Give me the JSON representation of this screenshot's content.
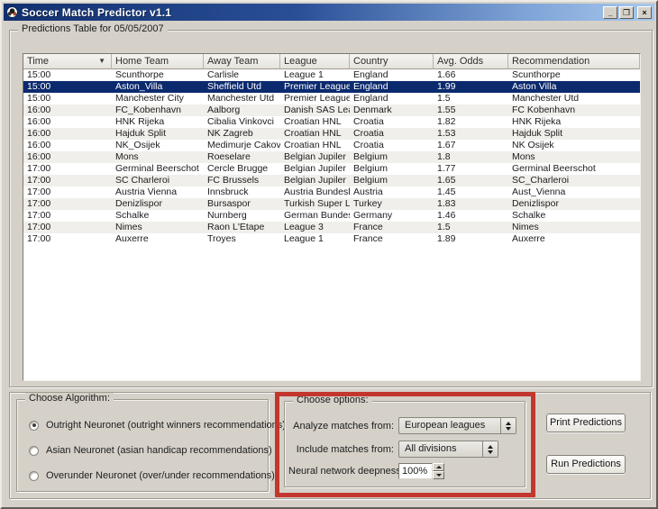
{
  "window": {
    "title": "Soccer Match Predictor v1.1",
    "controls": {
      "minimize": "_",
      "maximize": "❐",
      "close": "×"
    }
  },
  "colors": {
    "title_gradient_left": "#12306f",
    "title_gradient_right": "#a7c8ee",
    "selection": "#0b2a6e",
    "highlight_red": "#c2362d",
    "window_bg": "#d5d1c9"
  },
  "predictions_group": {
    "title": "Predictions Table for 05/05/2007"
  },
  "table": {
    "columns": [
      "Time",
      "Home Team",
      "Away Team",
      "League",
      "Country",
      "Avg. Odds",
      "Recommendation"
    ],
    "sort_column_index": 0,
    "sort_icon": "▼",
    "selected_row_index": 1,
    "rows": [
      [
        "15:00",
        "Scunthorpe",
        "Carlisle",
        "League 1",
        "England",
        "1.66",
        "Scunthorpe"
      ],
      [
        "15:00",
        "Aston_Villa",
        "Sheffield Utd",
        "Premier League",
        "England",
        "1.99",
        "Aston Villa"
      ],
      [
        "15:00",
        "Manchester City",
        "Manchester Utd",
        "Premier League",
        "England",
        "1.5",
        "Manchester Utd"
      ],
      [
        "16:00",
        "FC_Kobenhavn",
        "Aalborg",
        "Danish SAS League",
        "Denmark",
        "1.55",
        "FC Kobenhavn"
      ],
      [
        "16:00",
        "HNK Rijeka",
        "Cibalia Vinkovci",
        "Croatian HNL",
        "Croatia",
        "1.82",
        "HNK Rijeka"
      ],
      [
        "16:00",
        "Hajduk Split",
        "NK Zagreb",
        "Croatian HNL",
        "Croatia",
        "1.53",
        "Hajduk Split"
      ],
      [
        "16:00",
        "NK_Osijek",
        "Medimurje Cakovec",
        "Croatian HNL",
        "Croatia",
        "1.67",
        "NK Osijek"
      ],
      [
        "16:00",
        "Mons",
        "Roeselare",
        "Belgian Jupiler",
        "Belgium",
        "1.8",
        "Mons"
      ],
      [
        "17:00",
        "Germinal Beerschot",
        "Cercle Brugge",
        "Belgian Jupiler",
        "Belgium",
        "1.77",
        "Germinal Beerschot"
      ],
      [
        "17:00",
        "SC Charleroi",
        "FC Brussels",
        "Belgian Jupiler",
        "Belgium",
        "1.65",
        "SC_Charleroi"
      ],
      [
        "17:00",
        "Austria Vienna",
        "Innsbruck",
        "Austria Bundesliga",
        "Austria",
        "1.45",
        "Aust_Vienna"
      ],
      [
        "17:00",
        "Denizlispor",
        "Bursaspor",
        "Turkish Super Lea...",
        "Turkey",
        "1.83",
        "Denizlispor"
      ],
      [
        "17:00",
        "Schalke",
        "Nurnberg",
        "German Bundesliga",
        "Germany",
        "1.46",
        "Schalke"
      ],
      [
        "17:00",
        "Nimes",
        "Raon L'Etape",
        "League 3",
        "France",
        "1.5",
        "Nimes"
      ],
      [
        "17:00",
        "Auxerre",
        "Troyes",
        "League 1",
        "France",
        "1.89",
        "Auxerre"
      ]
    ]
  },
  "algorithm_group": {
    "title": "Choose Algorithm:",
    "options": [
      {
        "label": "Outright Neuronet  (outright winners recommendations)",
        "selected": true
      },
      {
        "label": "Asian Neuronet  (asian handicap recommendations)",
        "selected": false
      },
      {
        "label": "Overunder Neuronet  (over/under recommendations)",
        "selected": false
      }
    ]
  },
  "options_group": {
    "title": "Choose options:",
    "fields": [
      {
        "label": "Analyze matches from:",
        "value": "European leagues",
        "type": "dropdown"
      },
      {
        "label": "Include matches from:",
        "value": "All divisions",
        "type": "dropdown"
      },
      {
        "label": "Neural network deepness:",
        "value": "100%",
        "type": "spinner"
      }
    ]
  },
  "buttons": {
    "print": "Print Predictions",
    "run": "Run Predictions"
  }
}
